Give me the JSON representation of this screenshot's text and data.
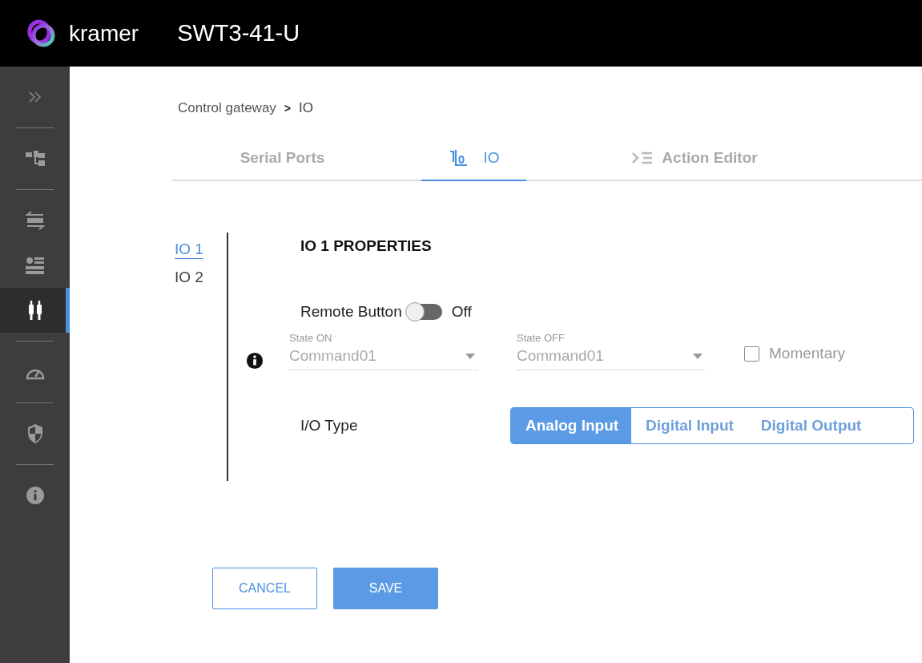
{
  "header": {
    "brand": "kramer",
    "title": "SWT3-41-U"
  },
  "sidebar": {
    "groups": [
      {
        "items": [
          {
            "kind": "expand",
            "selected": false
          }
        ]
      },
      {
        "items": [
          {
            "kind": "topology",
            "selected": false
          }
        ]
      },
      {
        "items": [
          {
            "kind": "auto",
            "selected": false
          },
          {
            "kind": "settings",
            "selected": false
          },
          {
            "kind": "io",
            "selected": true
          }
        ]
      },
      {
        "items": [
          {
            "kind": "gauge",
            "selected": false
          }
        ]
      },
      {
        "items": [
          {
            "kind": "shield",
            "selected": false
          }
        ]
      },
      {
        "items": [
          {
            "kind": "info",
            "selected": false
          }
        ]
      }
    ]
  },
  "breadcrumb": {
    "parent": "Control gateway",
    "separator": ">",
    "current": "IO"
  },
  "tabs": [
    {
      "label": "Serial Ports",
      "kind": "plain",
      "selected": false
    },
    {
      "label": "IO",
      "kind": "binary",
      "selected": true
    },
    {
      "label": "Action Editor",
      "kind": "action",
      "selected": false
    }
  ],
  "io_list": [
    {
      "label": "IO 1",
      "selected": true
    },
    {
      "label": "IO 2",
      "selected": false
    }
  ],
  "properties": {
    "title": "IO 1 PROPERTIES",
    "remote_button": {
      "label": "Remote Button",
      "on": false,
      "state_text": "Off"
    },
    "state_fields": [
      {
        "label": "State ON",
        "value": "Command01",
        "disabled": true
      },
      {
        "label": "State OFF",
        "value": "Command01",
        "disabled": true
      }
    ],
    "momentary": {
      "label": "Momentary",
      "checked": false
    },
    "io_type": {
      "label": "I/O Type",
      "options": [
        {
          "label": "Analog Input",
          "selected": true
        },
        {
          "label": "Digital Input",
          "selected": false
        },
        {
          "label": "Digital Output",
          "selected": false
        }
      ]
    }
  },
  "buttons": [
    {
      "label": "CANCEL",
      "kind": "outline"
    },
    {
      "label": "SAVE",
      "kind": "primary"
    }
  ]
}
